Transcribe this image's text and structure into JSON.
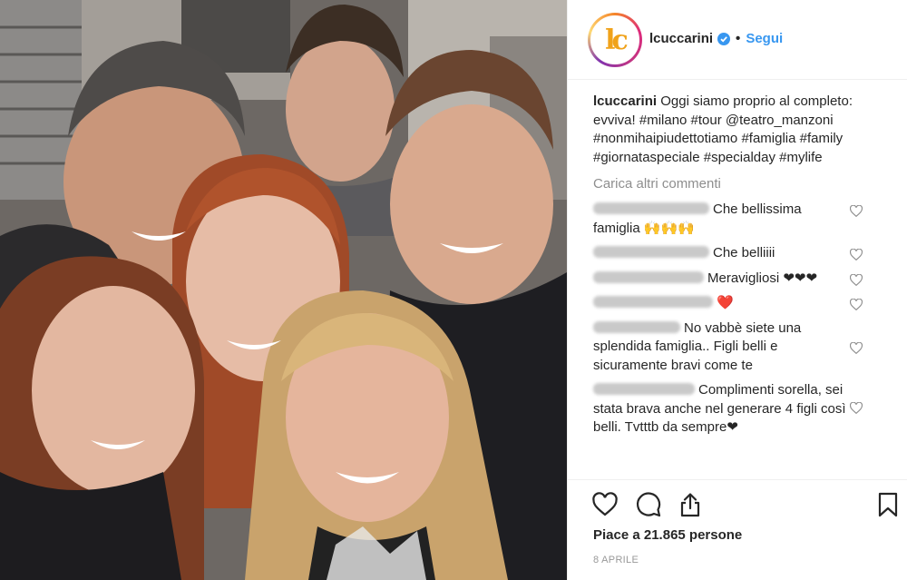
{
  "post": {
    "username": "lcuccarini",
    "follow_label": "Segui",
    "separator": "•",
    "avatar_text": "lc",
    "caption_text": "Oggi siamo proprio al completo: evviva! #milano #tour @teatro_manzoni #nonmihaipiudettotiamo #famiglia #family #giornataspeciale #specialday #mylife",
    "load_more": "Carica altri commenti",
    "likes": "Piace a 21.865 persone",
    "date": "8 APRILE"
  },
  "comments": [
    {
      "text": "Che bellissima famiglia 🙌🙌🙌"
    },
    {
      "text": "Che belliiii"
    },
    {
      "text": "Meravigliosi ❤❤❤"
    },
    {
      "text": "❤️"
    },
    {
      "text": "No vabbè siete una splendida famiglia.. Figli belli e sicuramente bravi come te"
    },
    {
      "text": "Complimenti sorella, sei stata brava anche nel generare 4 figli così belli. Tvtttb da sempre❤"
    }
  ],
  "colors": {
    "accent": "#3897f0",
    "text": "#262626",
    "muted": "#8e8e8e",
    "border": "#efefef"
  },
  "icons": [
    "verified-badge-icon",
    "heart-icon",
    "comment-icon",
    "share-icon",
    "bookmark-icon"
  ]
}
